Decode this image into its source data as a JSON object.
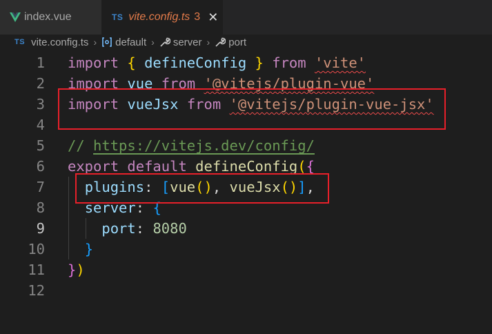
{
  "tabs": [
    {
      "label": "index.vue",
      "icon": "vue-logo-icon"
    },
    {
      "label": "vite.config.ts",
      "badge": "TS",
      "problems": "3",
      "close": "✕"
    }
  ],
  "breadcrumb": {
    "badge": "TS",
    "file": "vite.config.ts",
    "sep": "›",
    "items": [
      "default",
      "server",
      "port"
    ]
  },
  "editor": {
    "line_numbers": [
      "1",
      "2",
      "3",
      "4",
      "5",
      "6",
      "7",
      "8",
      "9",
      "10",
      "11",
      "12"
    ],
    "active_line": "9",
    "lines": [
      [
        {
          "t": "import",
          "c": "kw"
        },
        {
          "t": " "
        },
        {
          "t": "{",
          "c": "b1"
        },
        {
          "t": " "
        },
        {
          "t": "defineConfig",
          "c": "var"
        },
        {
          "t": " "
        },
        {
          "t": "}",
          "c": "b1"
        },
        {
          "t": " "
        },
        {
          "t": "from",
          "c": "kw"
        },
        {
          "t": " "
        },
        {
          "t": "'vite'",
          "c": "str squig"
        }
      ],
      [
        {
          "t": "import",
          "c": "kw"
        },
        {
          "t": " "
        },
        {
          "t": "vue",
          "c": "var"
        },
        {
          "t": " "
        },
        {
          "t": "from",
          "c": "kw"
        },
        {
          "t": " "
        },
        {
          "t": "'@vitejs/plugin-vue'",
          "c": "str squig"
        }
      ],
      [
        {
          "t": "import",
          "c": "kw"
        },
        {
          "t": " "
        },
        {
          "t": "vueJsx",
          "c": "var"
        },
        {
          "t": " "
        },
        {
          "t": "from",
          "c": "kw"
        },
        {
          "t": " "
        },
        {
          "t": "'@vitejs/plugin-vue-jsx'",
          "c": "str squig"
        }
      ],
      [],
      [
        {
          "t": "// ",
          "c": "cmt"
        },
        {
          "t": "https://vitejs.dev/config/",
          "c": "cmt link"
        }
      ],
      [
        {
          "t": "export",
          "c": "kw"
        },
        {
          "t": " "
        },
        {
          "t": "default",
          "c": "kw"
        },
        {
          "t": " "
        },
        {
          "t": "defineConfig",
          "c": "fn"
        },
        {
          "t": "(",
          "c": "b1"
        },
        {
          "t": "{",
          "c": "b2"
        }
      ],
      [
        {
          "t": "  "
        },
        {
          "t": "plugins",
          "c": "var"
        },
        {
          "t": ": "
        },
        {
          "t": "[",
          "c": "b3"
        },
        {
          "t": "vue",
          "c": "fn"
        },
        {
          "t": "()",
          "c": "b1"
        },
        {
          "t": ", "
        },
        {
          "t": "vueJsx",
          "c": "fn"
        },
        {
          "t": "()",
          "c": "b1"
        },
        {
          "t": "]",
          "c": "b3"
        },
        {
          "t": ","
        }
      ],
      [
        {
          "t": "  "
        },
        {
          "t": "server",
          "c": "var"
        },
        {
          "t": ": "
        },
        {
          "t": "{",
          "c": "b3"
        }
      ],
      [
        {
          "t": "    "
        },
        {
          "t": "port",
          "c": "var"
        },
        {
          "t": ": "
        },
        {
          "t": "8080",
          "c": "num"
        }
      ],
      [
        {
          "t": "  "
        },
        {
          "t": "}",
          "c": "b3"
        }
      ],
      [
        {
          "t": "}",
          "c": "b2"
        },
        {
          "t": ")",
          "c": "b1"
        }
      ],
      []
    ]
  },
  "colors": {
    "highlight_box": "#e8202a",
    "keyword": "#c586c0",
    "string": "#ce9178",
    "variable": "#9cdcfe"
  }
}
